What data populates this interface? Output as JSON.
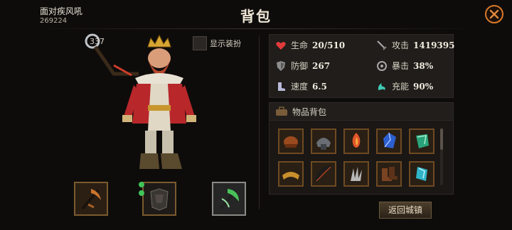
{
  "header": {
    "player_name": "面对疾风吼",
    "player_id": "269224",
    "title": "背包"
  },
  "character": {
    "power": "337"
  },
  "show_gear": {
    "label": "显示装扮",
    "checked": false
  },
  "equipment_slots": [
    {
      "icon": "pickaxe-weapon-icon"
    },
    {
      "icon": "dark-armor-icon"
    },
    {
      "icon": "green-axe-icon"
    }
  ],
  "stats": {
    "hp": {
      "label": "生命",
      "value": "20/510",
      "icon": "heart-icon"
    },
    "attack": {
      "label": "攻击",
      "value": "1419395",
      "icon": "sword-icon"
    },
    "defense": {
      "label": "防御",
      "value": "267",
      "icon": "shield-icon"
    },
    "crit": {
      "label": "暴击",
      "value": "38%",
      "icon": "crit-icon"
    },
    "speed": {
      "label": "速度",
      "value": "6.5",
      "icon": "boot-icon"
    },
    "charge": {
      "label": "充能",
      "value": "90%",
      "icon": "charge-icon"
    }
  },
  "bag": {
    "title": "物品背包",
    "items": [
      {
        "icon": "leather-glove-icon"
      },
      {
        "icon": "iron-helmet-icon"
      },
      {
        "icon": "flame-gem-icon"
      },
      {
        "icon": "blue-gem-icon"
      },
      {
        "icon": "emerald-shard-icon"
      },
      {
        "icon": "gold-crown-band-icon"
      },
      {
        "icon": "dark-bow-icon"
      },
      {
        "icon": "silver-claw-icon"
      },
      {
        "icon": "leather-boots-icon"
      },
      {
        "icon": "cyan-crystal-icon"
      }
    ]
  },
  "buttons": {
    "return_town": "返回城镇"
  },
  "colors": {
    "accent": "#d9792a",
    "frame_gold": "#7b5a2e",
    "background": "#0e0c0b"
  }
}
